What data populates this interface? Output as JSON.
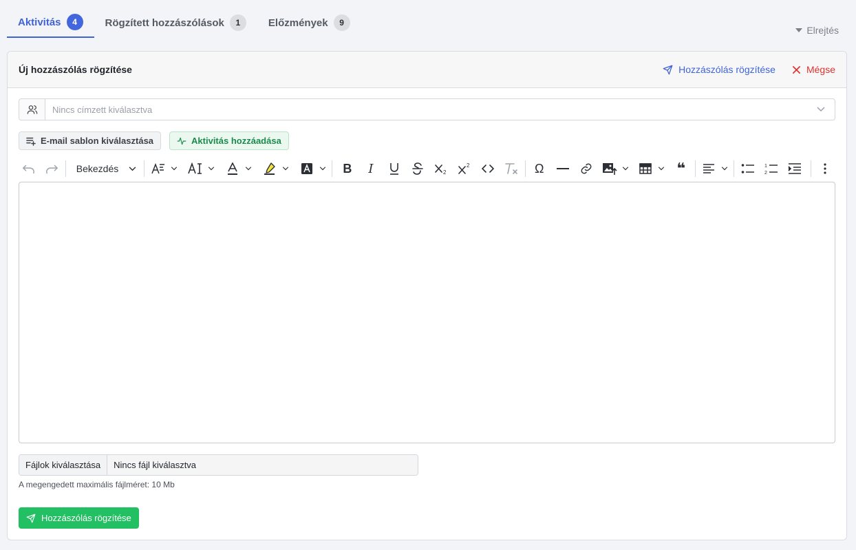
{
  "tabs": [
    {
      "label": "Aktivitás",
      "count": "4"
    },
    {
      "label": "Rögzített hozzászólások",
      "count": "1"
    },
    {
      "label": "Előzmények",
      "count": "9"
    }
  ],
  "hide_link": "Elrejtés",
  "card": {
    "title": "Új hozzászólás rögzítése",
    "submit_header_label": "Hozzászólás rögzítése",
    "cancel_label": "Mégse"
  },
  "recipient": {
    "placeholder": "Nincs címzett kiválasztva"
  },
  "buttons": {
    "email_template": "E-mail sablon kiválasztása",
    "add_activity": "Aktivitás hozzáadása"
  },
  "toolbar": {
    "paragraph": "Bekezdés",
    "icons": [
      "undo-icon",
      "redo-icon",
      "font-size-icon",
      "font-family-icon",
      "font-color-icon",
      "highlight-icon",
      "background-color-icon",
      "bold-icon",
      "italic-icon",
      "underline-icon",
      "strikethrough-icon",
      "subscript-icon",
      "superscript-icon",
      "code-icon",
      "remove-format-icon",
      "special-char-icon",
      "horizontal-line-icon",
      "link-icon",
      "image-upload-icon",
      "table-icon",
      "blockquote-icon",
      "align-icon",
      "bullet-list-icon",
      "numbered-list-icon",
      "indent-icon",
      "more-icon"
    ]
  },
  "file": {
    "button": "Fájlok kiválasztása",
    "status": "Nincs fájl kiválasztva",
    "hint": "A megengedett maximális fájlméret: 10 Mb"
  },
  "submit_label": "Hozzászólás rögzítése",
  "colors": {
    "accent_blue": "#3f63d6",
    "danger_red": "#e0312e",
    "success_green": "#22c062"
  }
}
